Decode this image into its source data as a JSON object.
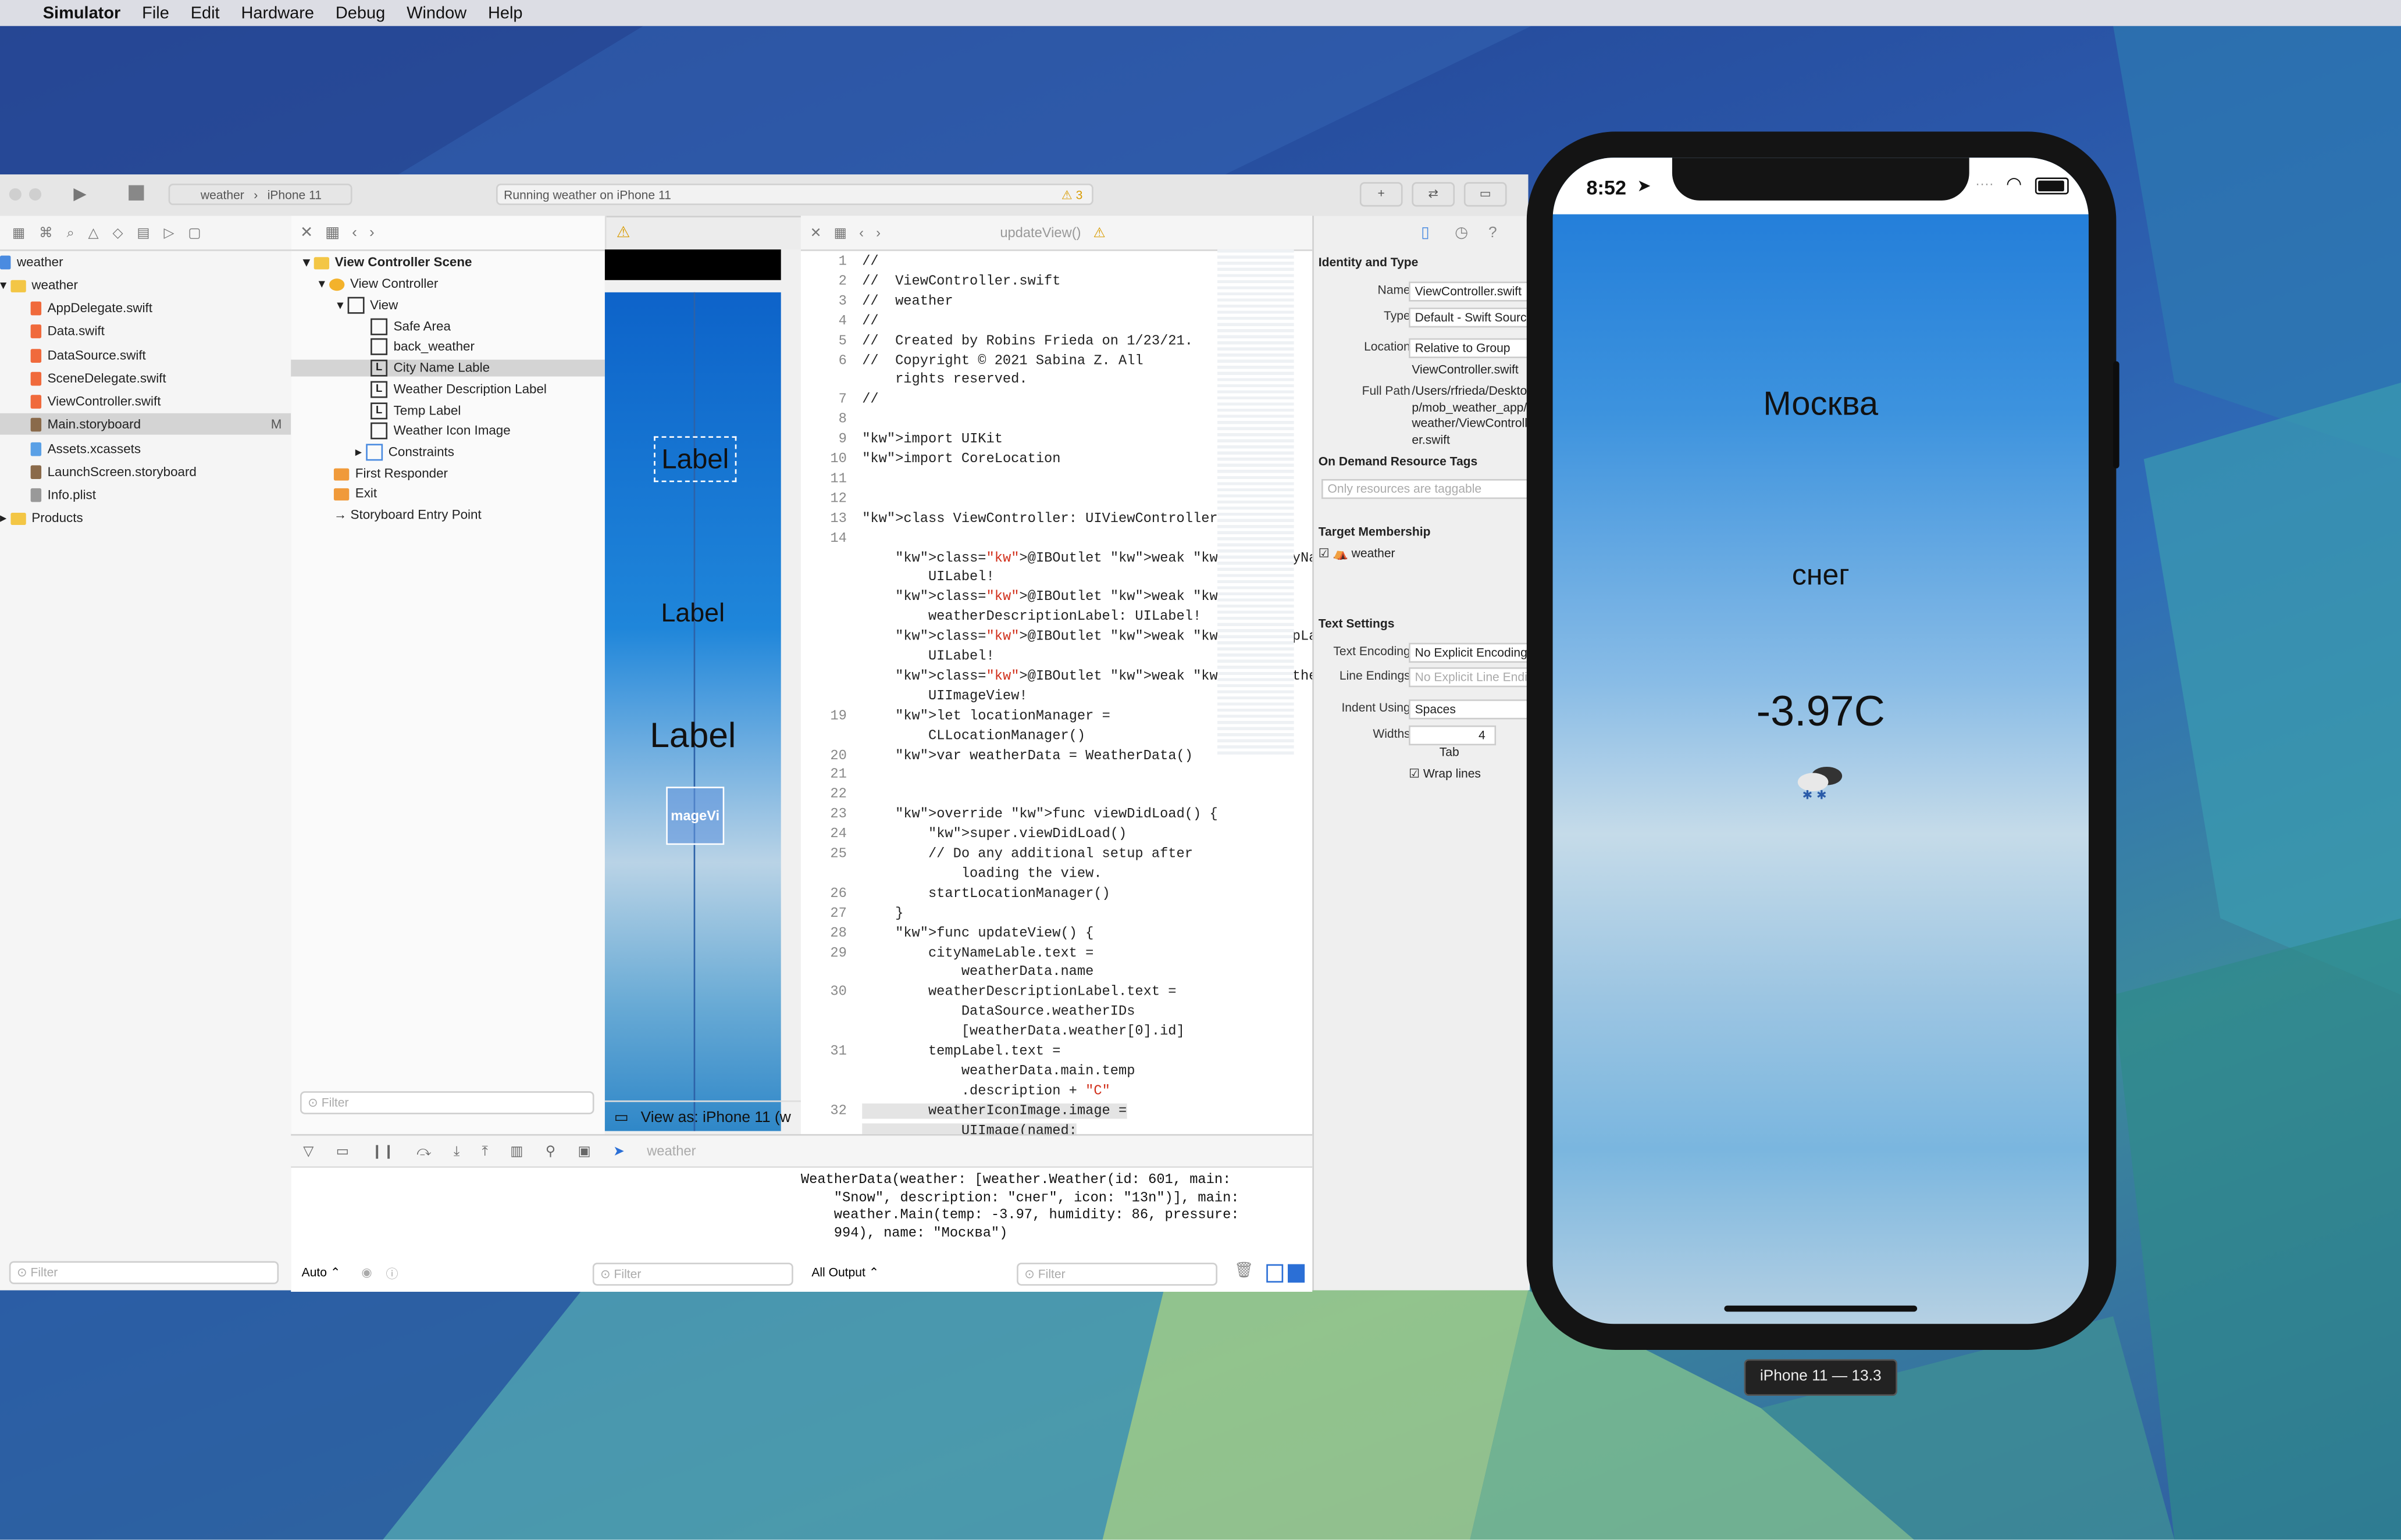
{
  "menubar": {
    "app": "Simulator",
    "items": [
      "File",
      "Edit",
      "Hardware",
      "Debug",
      "Window",
      "Help"
    ]
  },
  "toolbar": {
    "scheme": "weather",
    "device": "iPhone 11",
    "status": "Running weather on iPhone 11",
    "warnings": "3"
  },
  "navigator": {
    "items": [
      {
        "label": "weather",
        "kind": "project"
      },
      {
        "label": "weather",
        "kind": "folder"
      },
      {
        "label": "AppDelegate.swift",
        "kind": "swift"
      },
      {
        "label": "Data.swift",
        "kind": "swift"
      },
      {
        "label": "DataSource.swift",
        "kind": "swift"
      },
      {
        "label": "SceneDelegate.swift",
        "kind": "swift"
      },
      {
        "label": "ViewController.swift",
        "kind": "swift"
      },
      {
        "label": "Main.storyboard",
        "kind": "storyboard",
        "badge": "M"
      },
      {
        "label": "Assets.xcassets",
        "kind": "assets"
      },
      {
        "label": "LaunchScreen.storyboard",
        "kind": "storyboard"
      },
      {
        "label": "Info.plist",
        "kind": "plist"
      },
      {
        "label": "Products",
        "kind": "folder"
      }
    ],
    "filter_placeholder": "Filter"
  },
  "outline": {
    "items": [
      "View Controller Scene",
      "View Controller",
      "View",
      "Safe Area",
      "back_weather",
      "City Name Lable",
      "Weather Description Label",
      "Temp Label",
      "Weather Icon Image",
      "Constraints",
      "First Responder",
      "Exit",
      "Storyboard Entry Point"
    ],
    "filter_placeholder": "Filter"
  },
  "canvas": {
    "labels": [
      "Label",
      "Label",
      "Label"
    ],
    "image_label": "mageVi",
    "view_as": "View as: iPhone 11 (w"
  },
  "editor": {
    "breadcrumb": "updateView()",
    "line_numbers": [
      "1",
      "2",
      "3",
      "4",
      "5",
      "6",
      "",
      "7",
      "8",
      "9",
      "10",
      "11",
      "12",
      "13",
      "14",
      "",
      "",
      "",
      "",
      "",
      "",
      "",
      "",
      "19",
      "",
      "20",
      "21",
      "22",
      "23",
      "24",
      "25",
      "",
      "26",
      "27",
      "28",
      "29",
      "",
      "30",
      "",
      "",
      "31",
      "",
      "",
      "32",
      ""
    ],
    "lines": [
      "//",
      "//  ViewController.swift",
      "//  weather",
      "//",
      "//  Created by Robins Frieda on 1/23/21.",
      "//  Copyright © 2021 Sabina Z. All",
      "    rights reserved.",
      "//",
      "",
      "import UIKit",
      "import CoreLocation",
      "",
      "",
      "class ViewController: UIViewController {",
      "",
      "    @IBOutlet weak var cityNameLable:",
      "        UILabel!",
      "    @IBOutlet weak var",
      "        weatherDescriptionLabel: UILabel!",
      "    @IBOutlet weak var tempLabel:",
      "        UILabel!",
      "    @IBOutlet weak var weatherIconImage:",
      "        UIImageView!",
      "    let locationManager =",
      "        CLLocationManager()",
      "    var weatherData = WeatherData()",
      "",
      "",
      "    override func viewDidLoad() {",
      "        super.viewDidLoad()",
      "        // Do any additional setup after",
      "            loading the view.",
      "        startLocationManager()",
      "    }",
      "    func updateView() {",
      "        cityNameLable.text =",
      "            weatherData.name",
      "        weatherDescriptionLabel.text =",
      "            DataSource.weatherIDs",
      "            [weatherData.weather[0].id]",
      "        tempLabel.text =",
      "            weatherData.main.temp",
      "            .description + \"C\"",
      "        weatherIconImage.image =",
      "            UIImage(named:"
    ]
  },
  "inspector": {
    "identity_title": "Identity and Type",
    "name_label": "Name",
    "name_value": "ViewController.swift",
    "type_label": "Type",
    "type_value": "Default - Swift Source",
    "location_label": "Location",
    "location_value": "Relative to Group",
    "location_file": "ViewController.swift",
    "fullpath_label": "Full Path",
    "fullpath_value": "/Users/rfrieda/Desktop/mob_weather_app/weather/ViewController.swift",
    "ondemand_title": "On Demand Resource Tags",
    "ondemand_placeholder": "Only resources are taggable",
    "target_title": "Target Membership",
    "target_item": "weather",
    "text_title": "Text Settings",
    "encoding_label": "Text Encoding",
    "encoding_value": "No Explicit Encoding",
    "endings_label": "Line Endings",
    "endings_value": "No Explicit Line Endings",
    "indent_label": "Indent Using",
    "indent_value": "Spaces",
    "widths_label": "Widths",
    "widths_value": "4",
    "tab_label": "Tab",
    "wrap_label": "Wrap lines"
  },
  "debug": {
    "target": "weather",
    "console": "WeatherData(weather: [weather.Weather(id: 601, main:\n    \"Snow\", description: \"снег\", icon: \"13n\")], main:\n    weather.Main(temp: -3.97, humidity: 86, pressure:\n    994), name: \"Москва\")",
    "auto_label": "Auto",
    "output_label": "All Output",
    "filter_placeholder": "Filter"
  },
  "simulator": {
    "time": "8:52",
    "city": "Москва",
    "description": "снег",
    "temp": "-3.97C",
    "device_label": "iPhone 11 — 13.3"
  }
}
